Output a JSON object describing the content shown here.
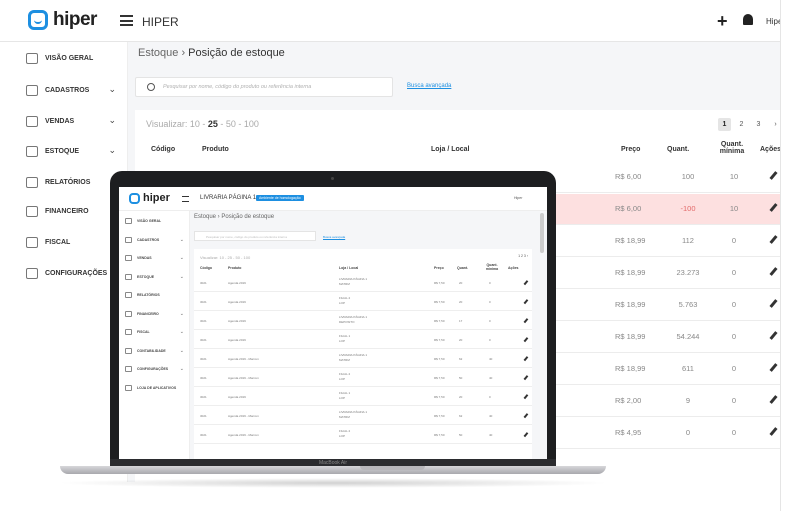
{
  "app": {
    "logo": "hiper",
    "title": "HIPER",
    "user": "Hiper"
  },
  "sidebar": {
    "items": [
      {
        "label": "VISÃO GERAL",
        "icon": "home-icon",
        "chevron": false
      },
      {
        "label": "CADASTROS",
        "icon": "id-card-icon",
        "chevron": true
      },
      {
        "label": "VENDAS",
        "icon": "store-icon",
        "chevron": true
      },
      {
        "label": "ESTOQUE",
        "icon": "boxes-icon",
        "chevron": true
      },
      {
        "label": "RELATÓRIOS",
        "icon": "bar-chart-icon",
        "chevron": false
      },
      {
        "label": "FINANCEIRO",
        "icon": "money-icon",
        "chevron": true
      },
      {
        "label": "FISCAL",
        "icon": "document-icon",
        "chevron": true
      },
      {
        "label": "CONFIGURAÇÕES",
        "icon": "gear-icon",
        "chevron": true
      }
    ]
  },
  "main": {
    "breadcrumb_parent": "Estoque",
    "breadcrumb_sep": "›",
    "breadcrumb_current": "Posição de estoque",
    "search_placeholder": "Pesquisar por nome, código do produto ou referência interna",
    "advanced_search": "Busca avançada",
    "visualizar_label": "Visualizar:",
    "page_sizes": [
      "10",
      "25",
      "50",
      "100"
    ],
    "pages": [
      "1",
      "2",
      "3",
      "›"
    ],
    "columns": {
      "codigo": "Código",
      "produto": "Produto",
      "loja": "Loja / Local",
      "preco": "Preço",
      "quant": "Quant.",
      "quant_min": "Quant. mínima",
      "acoes": "Ações"
    },
    "rows": [
      {
        "preco": "R$ 6,00",
        "quant": "100",
        "min": "10",
        "highlight": false
      },
      {
        "preco": "R$ 6,00",
        "quant": "-100",
        "min": "10",
        "highlight": true
      },
      {
        "preco": "R$ 18,99",
        "quant": "112",
        "min": "0",
        "highlight": false
      },
      {
        "preco": "R$ 18,99",
        "quant": "23.273",
        "min": "0",
        "highlight": false
      },
      {
        "preco": "R$ 18,99",
        "quant": "5.763",
        "min": "0",
        "highlight": false
      },
      {
        "preco": "R$ 18,99",
        "quant": "54.244",
        "min": "0",
        "highlight": false
      },
      {
        "preco": "R$ 18,99",
        "quant": "611",
        "min": "0",
        "highlight": false
      },
      {
        "preco": "R$ 2,00",
        "quant": "9",
        "min": "0",
        "highlight": false
      },
      {
        "preco": "R$ 4,95",
        "quant": "0",
        "min": "0",
        "highlight": false
      }
    ]
  },
  "laptop": {
    "brand": "MacBook Air",
    "screen": {
      "title": "LIVRARIA PÁGINA 1",
      "badge": "Ambiente de homologação",
      "user": "Hiper",
      "breadcrumb": "Estoque › Posição de estoque",
      "search_placeholder": "Pesquisar por nome, código do produto ou referência interna",
      "advanced_search": "Busca avançada",
      "visualizar": "Visualizar: 10 - 25 - 50 - 100",
      "pager": "1  2  3  ›",
      "columns": [
        "Código",
        "Produto",
        "Loja / Local",
        "Preço",
        "Quant.",
        "Quant. mínima",
        "Ações"
      ],
      "side_items": [
        {
          "label": "VISÃO GERAL",
          "chevron": false
        },
        {
          "label": "CADASTROS",
          "chevron": true
        },
        {
          "label": "VENDAS",
          "chevron": true
        },
        {
          "label": "ESTOQUE",
          "chevron": true
        },
        {
          "label": "RELATÓRIOS",
          "chevron": false
        },
        {
          "label": "FINANCEIRO",
          "chevron": true
        },
        {
          "label": "FISCAL",
          "chevron": true
        },
        {
          "label": "CONTABILIDADE",
          "chevron": true
        },
        {
          "label": "CONFIGURAÇÕES",
          "chevron": true
        },
        {
          "label": "LOJA DE APLICATIVOS",
          "chevron": false
        }
      ],
      "rows": [
        {
          "cod": "3021",
          "prod": "Agenda 2019",
          "loja": "LIVRARIA PÁGINA 1",
          "local": "MATRIZ",
          "preco": "R$ 7,50",
          "q": "20",
          "min": "0"
        },
        {
          "cod": "3021",
          "prod": "Agenda 2019",
          "loja": "FILIAL 2",
          "local": "LOP",
          "preco": "R$ 7,50",
          "q": "20",
          "min": "0"
        },
        {
          "cod": "3021",
          "prod": "Agenda 2019",
          "loja": "LIVRARIA PÁGINA 1",
          "local": "DEPOSITO",
          "preco": "R$ 7,50",
          "q": "17",
          "min": "0"
        },
        {
          "cod": "3021",
          "prod": "Agenda 2019",
          "loja": "FILIAL 1",
          "local": "LOP",
          "preco": "R$ 7,50",
          "q": "20",
          "min": "0"
        },
        {
          "cod": "3021",
          "prod": "Agenda 2019 - Marrom",
          "loja": "LIVRARIA PÁGINA 1",
          "local": "MATRIZ",
          "preco": "R$ 7,50",
          "q": "62",
          "min": "40"
        },
        {
          "cod": "3021",
          "prod": "Agenda 2019 - Marrom",
          "loja": "FILIAL 2",
          "local": "LOP",
          "preco": "R$ 7,50",
          "q": "50",
          "min": "40"
        },
        {
          "cod": "3021",
          "prod": "Agenda 2019",
          "loja": "FILIAL 1",
          "local": "LOP",
          "preco": "R$ 7,50",
          "q": "20",
          "min": "0"
        },
        {
          "cod": "3021",
          "prod": "Agenda 2019 - Marrom",
          "loja": "LIVRARIA PÁGINA 1",
          "local": "MATRIZ",
          "preco": "R$ 7,50",
          "q": "62",
          "min": "40"
        },
        {
          "cod": "3021",
          "prod": "Agenda 2019 - Marrom",
          "loja": "FILIAL 2",
          "local": "LOP",
          "preco": "R$ 7,50",
          "q": "50",
          "min": "40"
        }
      ]
    }
  }
}
